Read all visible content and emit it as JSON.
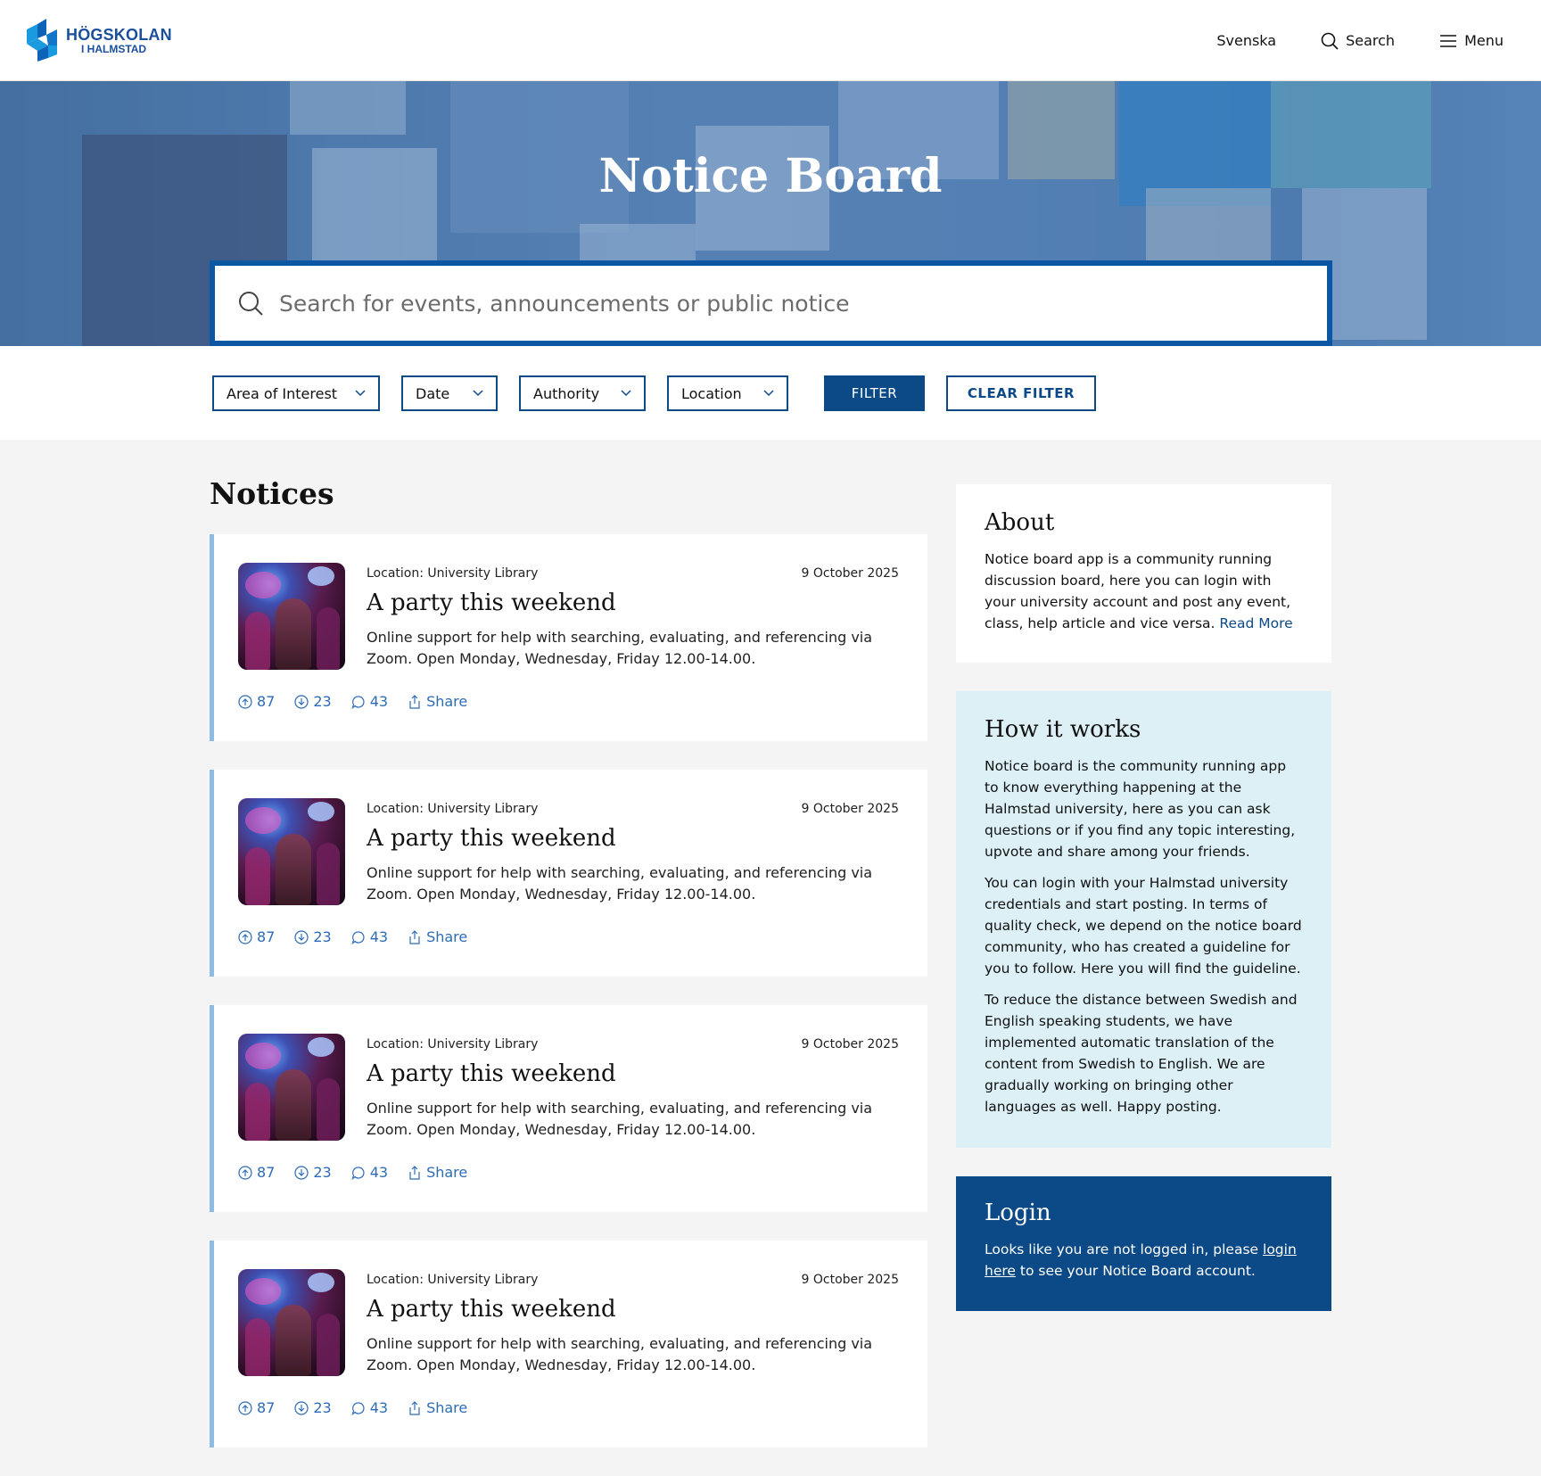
{
  "header": {
    "logo_line1": "HÖGSKOLAN",
    "logo_line2": "I HALMSTAD",
    "nav": {
      "language": "Svenska",
      "search": "Search",
      "menu": "Menu"
    }
  },
  "hero": {
    "title": "Notice Board",
    "search_placeholder": "Search for events, announcements or public notice"
  },
  "filters": {
    "dropdowns": [
      "Area of Interest",
      "Date",
      "Authority",
      "Location"
    ],
    "filter_button": "FILTER",
    "clear_button": "CLEAR FILTER"
  },
  "notices": {
    "heading": "Notices",
    "items": [
      {
        "location": "Location: University Library",
        "date": "9 October 2025",
        "title": "A party this weekend",
        "description": "Online support for help with searching, evaluating, and referencing via Zoom. Open Monday, Wednesday, Friday 12.00-14.00.",
        "upvotes": "87",
        "downvotes": "23",
        "comments": "43",
        "share": "Share"
      },
      {
        "location": "Location: University Library",
        "date": "9 October 2025",
        "title": "A party this weekend",
        "description": "Online support for help with searching, evaluating, and referencing via Zoom. Open Monday, Wednesday, Friday 12.00-14.00.",
        "upvotes": "87",
        "downvotes": "23",
        "comments": "43",
        "share": "Share"
      },
      {
        "location": "Location: University Library",
        "date": "9 October 2025",
        "title": "A party this weekend",
        "description": "Online support for help with searching, evaluating, and referencing via Zoom. Open Monday, Wednesday, Friday 12.00-14.00.",
        "upvotes": "87",
        "downvotes": "23",
        "comments": "43",
        "share": "Share"
      },
      {
        "location": "Location: University Library",
        "date": "9 October 2025",
        "title": "A party this weekend",
        "description": "Online support for help with searching, evaluating, and referencing via Zoom. Open Monday, Wednesday, Friday 12.00-14.00.",
        "upvotes": "87",
        "downvotes": "23",
        "comments": "43",
        "share": "Share"
      }
    ]
  },
  "sidebar": {
    "about": {
      "title": "About",
      "text": "Notice board app is a community running discussion board, here you can login with your university account and post any event, class, help article and vice versa.",
      "read_more": "Read More"
    },
    "how": {
      "title": "How it works",
      "p1": "Notice board is the community running app to know everything happening at the Halmstad university, here as you can ask questions or if you find any topic interesting, upvote and share among your friends.",
      "p2": "You can login with your Halmstad university credentials and start posting. In terms of quality check, we depend on the notice board community, who has created a guideline for you to follow. Here you will find the guideline.",
      "p3": "To reduce the distance between Swedish and English speaking students, we have implemented automatic translation of the content from Swedish to English. We are gradually working on bringing other languages as well. Happy posting."
    },
    "login": {
      "title": "Login",
      "text_before": "Looks like you are not logged in, please",
      "link": "login here",
      "text_after": "to see your Notice Board account."
    }
  },
  "colors": {
    "primary": "#0c4a87",
    "accent": "#2d6cb5",
    "card_border": "#8dbbe2",
    "how_bg": "#dcf0f6"
  },
  "icons": [
    "logo-mark",
    "search-icon",
    "menu-icon",
    "chevron-down-icon",
    "upvote-icon",
    "downvote-icon",
    "comment-icon",
    "share-icon"
  ]
}
